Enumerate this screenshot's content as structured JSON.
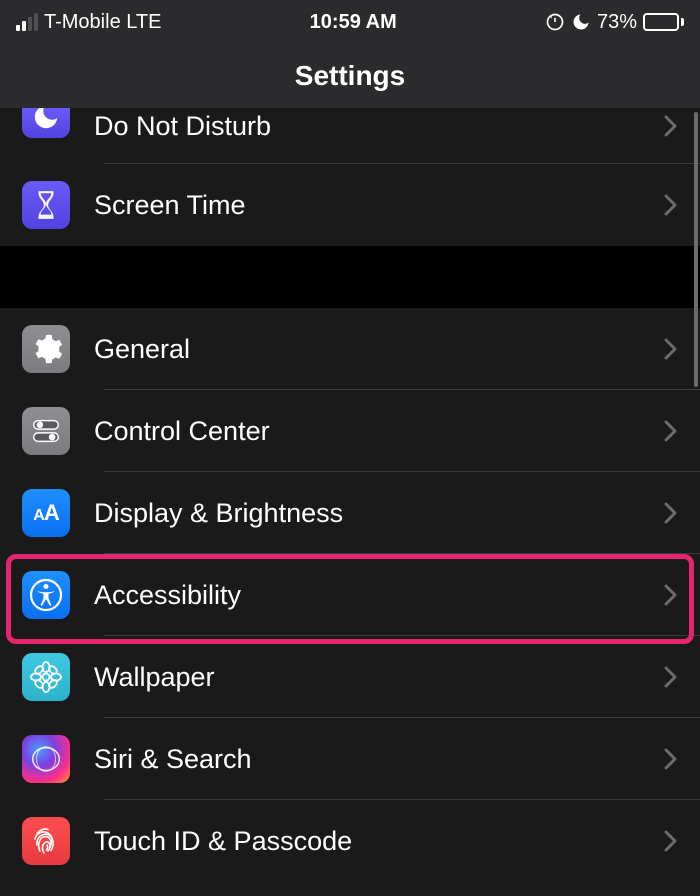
{
  "status": {
    "carrier": "T-Mobile LTE",
    "time": "10:59 AM",
    "battery_pct": "73%"
  },
  "header": {
    "title": "Settings"
  },
  "groups": [
    {
      "rows": [
        {
          "id": "do-not-disturb",
          "label": "Do Not Disturb",
          "icon": "moon-icon",
          "bg": "purple",
          "cut": true
        },
        {
          "id": "screen-time",
          "label": "Screen Time",
          "icon": "hourglass-icon",
          "bg": "purple"
        }
      ]
    },
    {
      "rows": [
        {
          "id": "general",
          "label": "General",
          "icon": "gear-icon",
          "bg": "gray"
        },
        {
          "id": "control-center",
          "label": "Control Center",
          "icon": "switches-icon",
          "bg": "gray"
        },
        {
          "id": "display-brightness",
          "label": "Display & Brightness",
          "icon": "text-size-icon",
          "bg": "blue"
        },
        {
          "id": "accessibility",
          "label": "Accessibility",
          "icon": "accessibility-icon",
          "bg": "blue",
          "highlighted": true
        },
        {
          "id": "wallpaper",
          "label": "Wallpaper",
          "icon": "flower-icon",
          "bg": "cyan"
        },
        {
          "id": "siri-search",
          "label": "Siri & Search",
          "icon": "siri-icon",
          "bg": "siri"
        },
        {
          "id": "touch-id",
          "label": "Touch ID & Passcode",
          "icon": "fingerprint-icon",
          "bg": "red"
        }
      ]
    }
  ]
}
